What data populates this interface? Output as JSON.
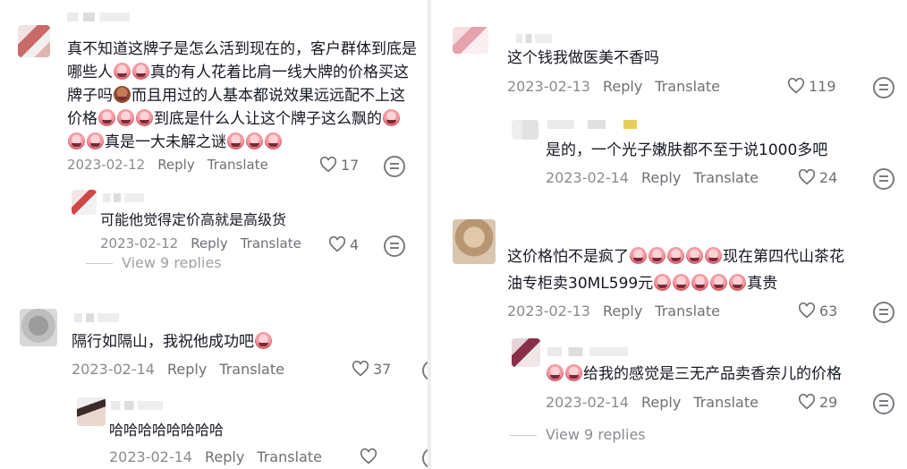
{
  "left": {
    "c1": {
      "lines": [
        "真不知道这牌子是怎么活到现在的，客户群体到底是",
        "哪些人",
        "真的有人花着比肩一线大牌的价格买这",
        "牌子吗",
        "而且用过的人基本都说效果远远配不上这",
        "价格",
        "到底是什么人让这个牌子这么飘的",
        "真是一大未解之谜"
      ],
      "date": "2023-02-12",
      "reply": "Reply",
      "translate": "Translate",
      "likes": "17"
    },
    "c1r1": {
      "text": "可能他觉得定价高就是高级货",
      "date": "2023-02-12",
      "reply": "Reply",
      "translate": "Translate",
      "likes": "4"
    },
    "c1_more": "View 9 replies",
    "c2": {
      "text": "隔行如隔山，我祝他成功吧",
      "date": "2023-02-14",
      "reply": "Reply",
      "translate": "Translate",
      "likes": "37"
    },
    "c2r1": {
      "text": "哈哈哈哈哈哈哈哈",
      "date": "2023-02-14",
      "reply": "Reply",
      "translate": "Translate"
    }
  },
  "right": {
    "c1": {
      "text": "这个钱我做医美不香吗",
      "date": "2023-02-13",
      "reply": "Reply",
      "translate": "Translate",
      "likes": "119"
    },
    "c1r1": {
      "text": "是的，一个光子嫩肤都不至于说1000多吧",
      "date": "2023-02-14",
      "reply": "Reply",
      "translate": "Translate",
      "likes": "24"
    },
    "c2": {
      "line1a": "这价格怕不是疯了",
      "line1b": "现在第四代山茶花",
      "line2a": "油专柜卖30ML599元",
      "line2b": "真贵",
      "date": "2023-02-13",
      "reply": "Reply",
      "translate": "Translate",
      "likes": "63"
    },
    "c2r1": {
      "text": "给我的感觉是三无产品卖香奈儿的价格",
      "date": "2023-02-14",
      "reply": "Reply",
      "translate": "Translate",
      "likes": "29"
    },
    "c2_more": "View 9 replies"
  },
  "icons": [
    "heart-icon",
    "dislike-icon",
    "crying-emoji-icon",
    "poop-emoji-icon"
  ]
}
